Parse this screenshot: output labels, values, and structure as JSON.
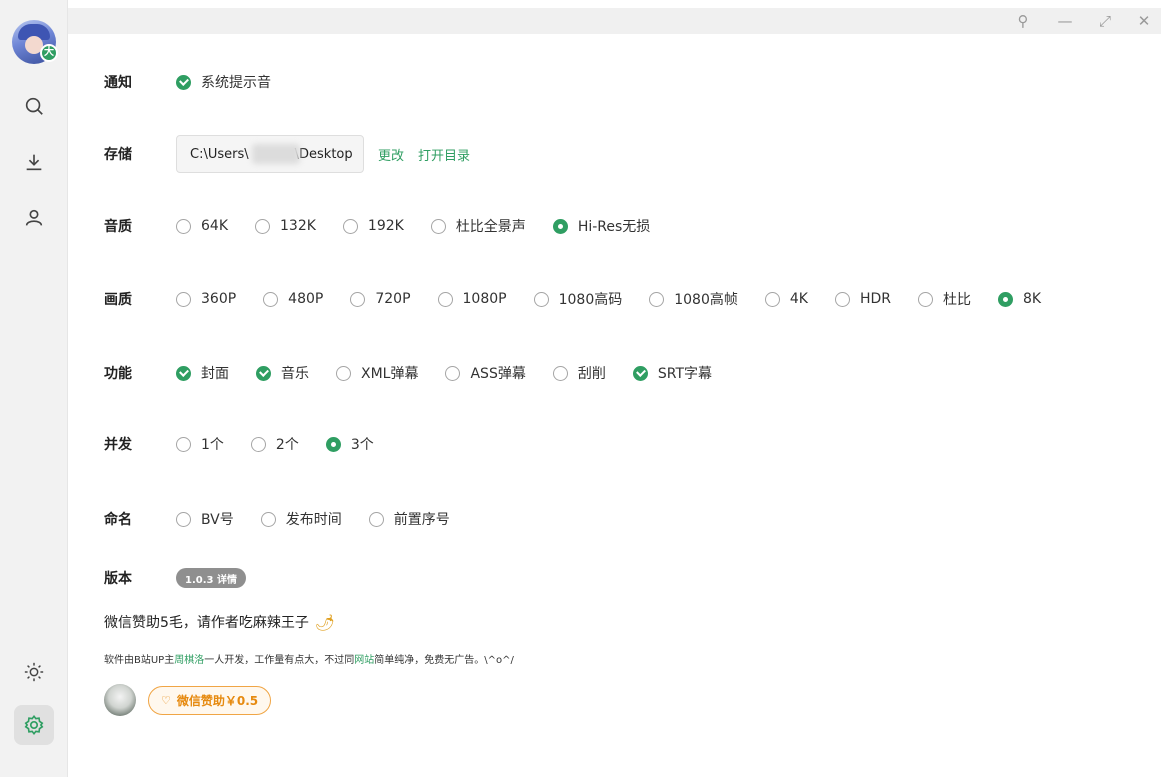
{
  "window_controls": {
    "pin": "⚲",
    "minimize": "—",
    "restore": "⤢",
    "close": "✕"
  },
  "sidebar": {
    "avatar_badge": "大",
    "items": [
      {
        "name": "search-icon"
      },
      {
        "name": "download-icon"
      },
      {
        "name": "user-icon"
      },
      {
        "name": "theme-sun-icon"
      },
      {
        "name": "settings-icon",
        "active": true
      }
    ]
  },
  "settings": {
    "notify": {
      "label": "通知",
      "options": [
        {
          "text": "系统提示音",
          "checked": true
        }
      ]
    },
    "storage": {
      "label": "存储",
      "path_prefix": "C:\\Users\\",
      "path_suffix": "\\Desktop",
      "change": "更改",
      "open_dir": "打开目录"
    },
    "audio": {
      "label": "音质",
      "options": [
        "64K",
        "132K",
        "192K",
        "杜比全景声",
        "Hi-Res无损"
      ],
      "selected": "Hi-Res无损"
    },
    "video": {
      "label": "画质",
      "options": [
        "360P",
        "480P",
        "720P",
        "1080P",
        "1080高码",
        "1080高帧",
        "4K",
        "HDR",
        "杜比",
        "8K"
      ],
      "selected": "8K"
    },
    "features": {
      "label": "功能",
      "options": [
        {
          "text": "封面",
          "checked": true
        },
        {
          "text": "音乐",
          "checked": true
        },
        {
          "text": "XML弹幕",
          "checked": false
        },
        {
          "text": "ASS弹幕",
          "checked": false
        },
        {
          "text": "刮削",
          "checked": false
        },
        {
          "text": "SRT字幕",
          "checked": true
        }
      ]
    },
    "concurrency": {
      "label": "并发",
      "options": [
        "1个",
        "2个",
        "3个"
      ],
      "selected": "3个"
    },
    "naming": {
      "label": "命名",
      "options": [
        "BV号",
        "发布时间",
        "前置序号"
      ]
    },
    "version": {
      "label": "版本",
      "badge": "1.0.3 详情"
    }
  },
  "donate": {
    "title": "微信赞助5毛，请作者吃麻辣王子",
    "title_emoji": "🌶",
    "note_1": "软件由B站UP主",
    "author": "周棋洛",
    "note_2": "一人开发，工作量有点大，不过同",
    "site": "网站",
    "note_3": "简单纯净，免费无广告。\\^o^/",
    "button": "微信赞助￥0.5",
    "button_icon": "♡"
  },
  "colors": {
    "accent": "#2f9e62",
    "donate": "#e68a10"
  }
}
